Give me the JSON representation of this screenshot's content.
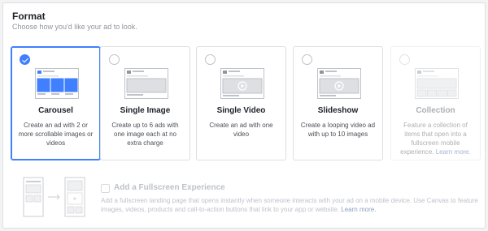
{
  "format": {
    "title": "Format",
    "subtitle": "Choose how you'd like your ad to look."
  },
  "cards": [
    {
      "name": "Carousel",
      "description": "Create an ad with 2 or more scrollable images or videos",
      "selected": true,
      "disabled": false,
      "thumbnail": "carousel-thumbnail"
    },
    {
      "name": "Single Image",
      "description": "Create up to 6 ads with one image each at no extra charge",
      "selected": false,
      "disabled": false,
      "thumbnail": "single-image-thumbnail"
    },
    {
      "name": "Single Video",
      "description": "Create an ad with one video",
      "selected": false,
      "disabled": false,
      "thumbnail": "single-video-thumbnail"
    },
    {
      "name": "Slideshow",
      "description": "Create a looping video ad with up to 10 images",
      "selected": false,
      "disabled": false,
      "thumbnail": "slideshow-thumbnail"
    },
    {
      "name": "Collection",
      "description": "Feature a collection of items that open into a fullscreen mobile experience.",
      "link": "Learn more.",
      "selected": false,
      "disabled": true,
      "thumbnail": "collection-thumbnail"
    }
  ],
  "fullscreen": {
    "title": "Add a Fullscreen Experience",
    "description": "Add a fullscreen landing page that opens instantly when someone interacts with your ad on a mobile device. Use Canvas to feature images, videos, products and call-to-action buttons that link to your app or website.",
    "link": "Learn more.",
    "checked": false,
    "disabled": true
  },
  "colors": {
    "accent": "#4080ff",
    "border": "#dddfe2",
    "link": "#365899",
    "muted_text": "#90949c"
  }
}
